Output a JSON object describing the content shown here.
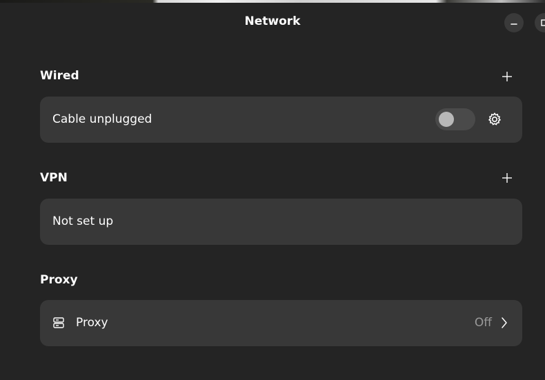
{
  "window": {
    "title": "Network"
  },
  "sections": {
    "wired": {
      "title": "Wired",
      "add_icon": "plus-icon",
      "row": {
        "label": "Cable unplugged",
        "toggle_on": false,
        "settings_icon": "gear-icon"
      }
    },
    "vpn": {
      "title": "VPN",
      "add_icon": "plus-icon",
      "row": {
        "label": "Not set up"
      }
    },
    "proxy": {
      "title": "Proxy",
      "row": {
        "icon": "server-icon",
        "label": "Proxy",
        "status": "Off",
        "chevron_icon": "chevron-right-icon"
      }
    }
  },
  "colors": {
    "background": "#242424",
    "card": "#383838",
    "secondary_text": "#9a9a9a"
  }
}
